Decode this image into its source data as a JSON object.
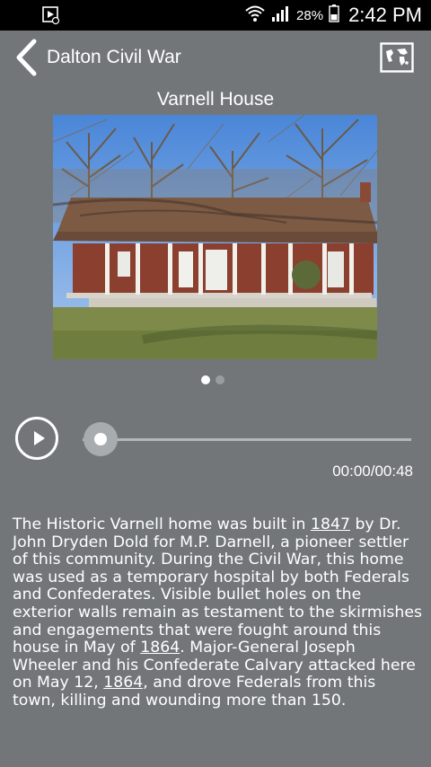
{
  "status_bar": {
    "battery_percent": "28%",
    "time": "2:42 PM"
  },
  "app_bar": {
    "title": "Dalton Civil War"
  },
  "place": {
    "title": "Varnell House"
  },
  "carousel": {
    "active_index": 0,
    "count": 2
  },
  "player": {
    "time_display": "00:00/00:48",
    "progress": 0
  },
  "description": {
    "parts": [
      {
        "text": "The Historic Varnell home was built in ",
        "link": false
      },
      {
        "text": "1847",
        "link": true
      },
      {
        "text": " by Dr. John Dryden Dold for M.P. Darnell, a pioneer settler of this community. During the Civil War, this home was used as a temporary hospital by both Federals and Confederates. Visible bullet holes on the exterior walls remain as testament to the skirmishes and engagements that were fought around this house in May of ",
        "link": false
      },
      {
        "text": "1864",
        "link": true
      },
      {
        "text": ". Major-General Joseph Wheeler and his Confederate Calvary attacked here on May 12, ",
        "link": false
      },
      {
        "text": "1864",
        "link": true
      },
      {
        "text": ", and drove Federals from this town, killing and wounding more than 150.",
        "link": false
      }
    ]
  }
}
